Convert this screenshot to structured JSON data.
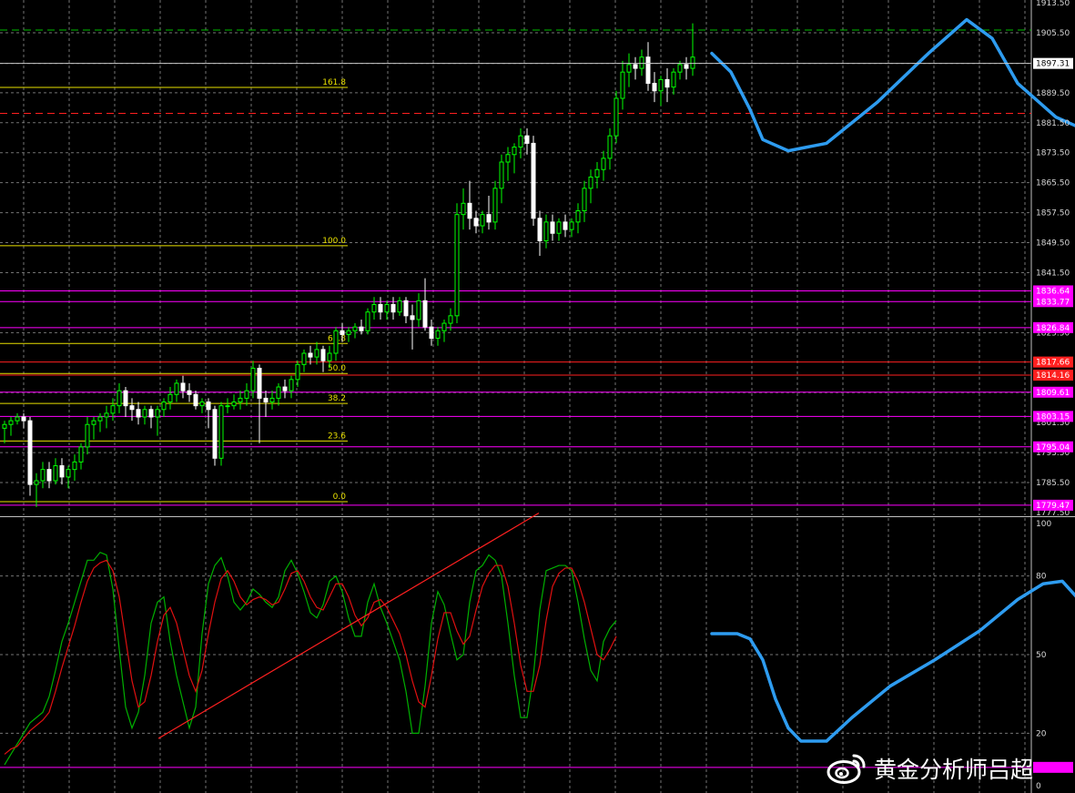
{
  "chart_data": [
    {
      "type": "candlestick",
      "title": "",
      "ylim": [
        1777.5,
        1913.5
      ],
      "yticks": [
        "1913.50",
        "1905.50",
        "1897.31",
        "1889.50",
        "1881.50",
        "1873.50",
        "1865.50",
        "1857.50",
        "1849.50",
        "1841.50",
        "1836.64",
        "1833.77",
        "1826.84",
        "1825.50",
        "1817.66",
        "1814.16",
        "1809.61",
        "1803.15",
        "1801.50",
        "1795.04",
        "1793.50",
        "1785.50",
        "1779.47",
        "1777.50"
      ],
      "grid": true,
      "bullish_color": "#00ff00",
      "bearish_color": "#ffffff",
      "candles": [
        [
          1800,
          1802,
          1796,
          1801
        ],
        [
          1801,
          1803,
          1798,
          1802
        ],
        [
          1802,
          1804,
          1801,
          1803
        ],
        [
          1803,
          1804,
          1800,
          1802
        ],
        [
          1802,
          1803,
          1782,
          1785
        ],
        [
          1785,
          1788,
          1779,
          1786
        ],
        [
          1786,
          1791,
          1784,
          1789
        ],
        [
          1789,
          1791,
          1784,
          1786
        ],
        [
          1786,
          1792,
          1785,
          1790
        ],
        [
          1790,
          1792,
          1785,
          1787
        ],
        [
          1787,
          1790,
          1784,
          1789
        ],
        [
          1789,
          1793,
          1786,
          1791
        ],
        [
          1791,
          1796,
          1789,
          1795
        ],
        [
          1795,
          1803,
          1793,
          1801
        ],
        [
          1801,
          1803,
          1797,
          1802
        ],
        [
          1802,
          1804,
          1799,
          1803
        ],
        [
          1803,
          1806,
          1800,
          1804
        ],
        [
          1804,
          1808,
          1802,
          1806
        ],
        [
          1806,
          1812,
          1804,
          1810
        ],
        [
          1810,
          1811,
          1803,
          1806
        ],
        [
          1806,
          1808,
          1802,
          1805
        ],
        [
          1805,
          1807,
          1801,
          1803
        ],
        [
          1803,
          1806,
          1801,
          1805
        ],
        [
          1805,
          1806,
          1800,
          1803
        ],
        [
          1803,
          1806,
          1798,
          1805
        ],
        [
          1805,
          1808,
          1803,
          1807
        ],
        [
          1807,
          1811,
          1805,
          1809
        ],
        [
          1809,
          1813,
          1807,
          1812
        ],
        [
          1812,
          1814,
          1808,
          1810
        ],
        [
          1810,
          1812,
          1807,
          1809
        ],
        [
          1809,
          1810,
          1805,
          1806
        ],
        [
          1806,
          1808,
          1804,
          1807
        ],
        [
          1807,
          1808,
          1800,
          1805
        ],
        [
          1805,
          1806,
          1790,
          1792
        ],
        [
          1792,
          1807,
          1790,
          1806
        ],
        [
          1806,
          1808,
          1804,
          1806
        ],
        [
          1806,
          1809,
          1805,
          1807
        ],
        [
          1807,
          1810,
          1805,
          1808
        ],
        [
          1808,
          1812,
          1806,
          1810
        ],
        [
          1810,
          1818,
          1808,
          1816
        ],
        [
          1816,
          1817,
          1796,
          1808
        ],
        [
          1808,
          1810,
          1803,
          1807
        ],
        [
          1807,
          1810,
          1805,
          1808
        ],
        [
          1808,
          1812,
          1806,
          1811
        ],
        [
          1811,
          1813,
          1808,
          1810
        ],
        [
          1810,
          1814,
          1808,
          1813
        ],
        [
          1813,
          1818,
          1811,
          1817
        ],
        [
          1817,
          1821,
          1815,
          1820
        ],
        [
          1820,
          1822,
          1817,
          1819
        ],
        [
          1819,
          1823,
          1817,
          1821
        ],
        [
          1821,
          1822,
          1815,
          1818
        ],
        [
          1818,
          1822,
          1816,
          1820
        ],
        [
          1820,
          1827,
          1818,
          1826
        ],
        [
          1826,
          1828,
          1823,
          1825
        ],
        [
          1825,
          1827,
          1823,
          1826
        ],
        [
          1826,
          1828,
          1824,
          1827
        ],
        [
          1827,
          1829,
          1825,
          1826
        ],
        [
          1826,
          1832,
          1825,
          1831
        ],
        [
          1831,
          1835,
          1829,
          1833
        ],
        [
          1833,
          1835,
          1829,
          1831
        ],
        [
          1831,
          1834,
          1829,
          1833
        ],
        [
          1833,
          1835,
          1829,
          1831
        ],
        [
          1831,
          1835,
          1830,
          1834
        ],
        [
          1834,
          1835,
          1828,
          1830
        ],
        [
          1830,
          1833,
          1821,
          1829
        ],
        [
          1829,
          1836,
          1827,
          1834
        ],
        [
          1834,
          1840,
          1826,
          1827
        ],
        [
          1827,
          1829,
          1822,
          1824
        ],
        [
          1824,
          1827,
          1822,
          1826
        ],
        [
          1826,
          1829,
          1823,
          1828
        ],
        [
          1828,
          1832,
          1826,
          1830
        ],
        [
          1830,
          1860,
          1828,
          1857
        ],
        [
          1857,
          1864,
          1853,
          1860
        ],
        [
          1860,
          1866,
          1853,
          1856
        ],
        [
          1856,
          1858,
          1852,
          1854
        ],
        [
          1854,
          1858,
          1852,
          1857
        ],
        [
          1857,
          1862,
          1853,
          1855
        ],
        [
          1855,
          1866,
          1853,
          1864
        ],
        [
          1864,
          1873,
          1860,
          1871
        ],
        [
          1871,
          1875,
          1866,
          1873
        ],
        [
          1873,
          1876,
          1868,
          1875
        ],
        [
          1875,
          1880,
          1872,
          1878
        ],
        [
          1878,
          1880,
          1873,
          1876
        ],
        [
          1876,
          1878,
          1854,
          1856
        ],
        [
          1856,
          1858,
          1846,
          1850
        ],
        [
          1850,
          1857,
          1848,
          1855
        ],
        [
          1855,
          1857,
          1850,
          1852
        ],
        [
          1852,
          1856,
          1850,
          1855
        ],
        [
          1855,
          1857,
          1851,
          1853
        ],
        [
          1853,
          1856,
          1851,
          1855
        ],
        [
          1855,
          1860,
          1852,
          1858
        ],
        [
          1858,
          1866,
          1855,
          1864
        ],
        [
          1864,
          1869,
          1860,
          1867
        ],
        [
          1867,
          1871,
          1864,
          1869
        ],
        [
          1869,
          1874,
          1866,
          1872
        ],
        [
          1872,
          1880,
          1869,
          1878
        ],
        [
          1878,
          1890,
          1876,
          1888
        ],
        [
          1888,
          1898,
          1885,
          1895
        ],
        [
          1895,
          1900,
          1891,
          1897
        ],
        [
          1897,
          1899,
          1893,
          1896
        ],
        [
          1896,
          1901,
          1894,
          1899
        ],
        [
          1899,
          1903,
          1890,
          1892
        ],
        [
          1892,
          1895,
          1887,
          1890
        ],
        [
          1890,
          1894,
          1886,
          1893
        ],
        [
          1893,
          1896,
          1887,
          1891
        ],
        [
          1891,
          1896,
          1889,
          1895
        ],
        [
          1895,
          1898,
          1893,
          1897
        ],
        [
          1897,
          1899,
          1893,
          1896
        ],
        [
          1896,
          1908,
          1894,
          1899
        ]
      ],
      "fibonacci": [
        {
          "label": "161.8",
          "value": 1890.9
        },
        {
          "label": "100.0",
          "value": 1848.7
        },
        {
          "label": "61.8",
          "value": 1822.6
        },
        {
          "label": "50.0",
          "value": 1814.6
        },
        {
          "label": "38.2",
          "value": 1806.6
        },
        {
          "label": "23.6",
          "value": 1796.6
        },
        {
          "label": "0.0",
          "value": 1780.4
        }
      ],
      "fib_color": "#e8e000",
      "horizontal_levels": [
        {
          "label": "1836.64",
          "value": 1836.64,
          "color": "#ff00ff"
        },
        {
          "label": "1833.77",
          "value": 1833.77,
          "color": "#ff00ff"
        },
        {
          "label": "1826.84",
          "value": 1826.84,
          "color": "#ff00ff"
        },
        {
          "label": "1817.66",
          "value": 1817.66,
          "color": "#ff2020"
        },
        {
          "label": "1814.16",
          "value": 1814.16,
          "color": "#ff2020"
        },
        {
          "label": "1809.61",
          "value": 1809.61,
          "color": "#ff00ff"
        },
        {
          "label": "1803.15",
          "value": 1803.15,
          "color": "#ff00ff"
        },
        {
          "label": "1795.04",
          "value": 1795.04,
          "color": "#ff00ff"
        },
        {
          "label": "1779.47",
          "value": 1779.47,
          "color": "#ff00ff"
        }
      ],
      "current_price": {
        "label": "1897.31",
        "value": 1897.31
      },
      "dashed_levels": [
        {
          "value": 1906.2,
          "color": "#00c000"
        },
        {
          "value": 1884.0,
          "color": "#ff2020"
        }
      ],
      "forecast_path": {
        "color": "#2e9cf0",
        "start_bar": 111,
        "points": [
          [
            0,
            1900
          ],
          [
            3,
            1895
          ],
          [
            6,
            1885
          ],
          [
            8,
            1877
          ],
          [
            12,
            1874
          ],
          [
            18,
            1876
          ],
          [
            26,
            1887
          ],
          [
            34,
            1900
          ],
          [
            40,
            1909
          ],
          [
            44,
            1904
          ],
          [
            48,
            1892
          ],
          [
            54,
            1883
          ],
          [
            58,
            1880
          ],
          [
            63,
            1884
          ],
          [
            70,
            1893
          ],
          [
            74,
            1894
          ],
          [
            80,
            1882
          ],
          [
            86,
            1871
          ]
        ]
      }
    },
    {
      "type": "line",
      "title": "",
      "ylim": [
        0,
        100
      ],
      "yticks": [
        "100",
        "80",
        "50",
        "20",
        "0"
      ],
      "grid": true,
      "series": [
        {
          "color": "#00b000",
          "values": [
            8,
            12,
            16,
            20,
            24,
            26,
            28,
            34,
            44,
            55,
            62,
            70,
            78,
            86,
            86,
            89,
            88,
            75,
            52,
            30,
            22,
            28,
            42,
            62,
            70,
            72,
            55,
            42,
            32,
            22,
            30,
            58,
            77,
            84,
            87,
            80,
            70,
            67,
            70,
            75,
            73,
            70,
            68,
            72,
            82,
            86,
            81,
            74,
            66,
            64,
            69,
            78,
            80,
            74,
            64,
            57,
            57,
            70,
            77,
            68,
            62,
            55,
            48,
            36,
            20,
            20,
            38,
            62,
            74,
            69,
            58,
            48,
            50,
            70,
            82,
            84,
            88,
            86,
            80,
            62,
            42,
            26,
            26,
            42,
            67,
            82,
            83,
            84,
            84,
            82,
            70,
            56,
            44,
            40,
            55,
            60,
            63
          ]
        },
        {
          "color": "#e01010",
          "values": [
            12,
            14,
            15,
            18,
            21,
            23,
            25,
            28,
            36,
            45,
            53,
            61,
            70,
            78,
            83,
            85,
            86,
            82,
            72,
            56,
            40,
            30,
            32,
            42,
            55,
            65,
            68,
            62,
            52,
            42,
            36,
            44,
            58,
            70,
            79,
            82,
            78,
            72,
            69,
            71,
            72,
            71,
            69,
            70,
            75,
            81,
            82,
            78,
            72,
            68,
            67,
            72,
            77,
            77,
            72,
            65,
            61,
            64,
            70,
            71,
            68,
            63,
            58,
            50,
            40,
            32,
            30,
            42,
            56,
            66,
            66,
            59,
            54,
            57,
            67,
            76,
            81,
            84,
            84,
            76,
            62,
            46,
            36,
            36,
            46,
            63,
            76,
            81,
            83,
            83,
            78,
            70,
            60,
            50,
            48,
            52,
            57
          ]
        }
      ],
      "trendline": {
        "color": "#ff2020",
        "from": [
          27,
          18
        ],
        "to": [
          91,
          104
        ]
      },
      "horizontal_levels": [
        {
          "label": "",
          "value": 7,
          "color": "#ff00ff"
        }
      ],
      "forecast_path": {
        "color": "#2e9cf0",
        "start_bar": 111,
        "points": [
          [
            0,
            58
          ],
          [
            4,
            58
          ],
          [
            6,
            56
          ],
          [
            8,
            48
          ],
          [
            10,
            33
          ],
          [
            12,
            22
          ],
          [
            14,
            17
          ],
          [
            18,
            17
          ],
          [
            22,
            26
          ],
          [
            28,
            38
          ],
          [
            35,
            48
          ],
          [
            42,
            59
          ],
          [
            48,
            71
          ],
          [
            52,
            77
          ],
          [
            55,
            78
          ],
          [
            58,
            70
          ],
          [
            62,
            58
          ],
          [
            67,
            48
          ],
          [
            70,
            40
          ],
          [
            73,
            42
          ],
          [
            76,
            48
          ]
        ]
      }
    }
  ],
  "watermark": {
    "text": "黄金分析师吕超",
    "icon": "weibo-icon"
  }
}
